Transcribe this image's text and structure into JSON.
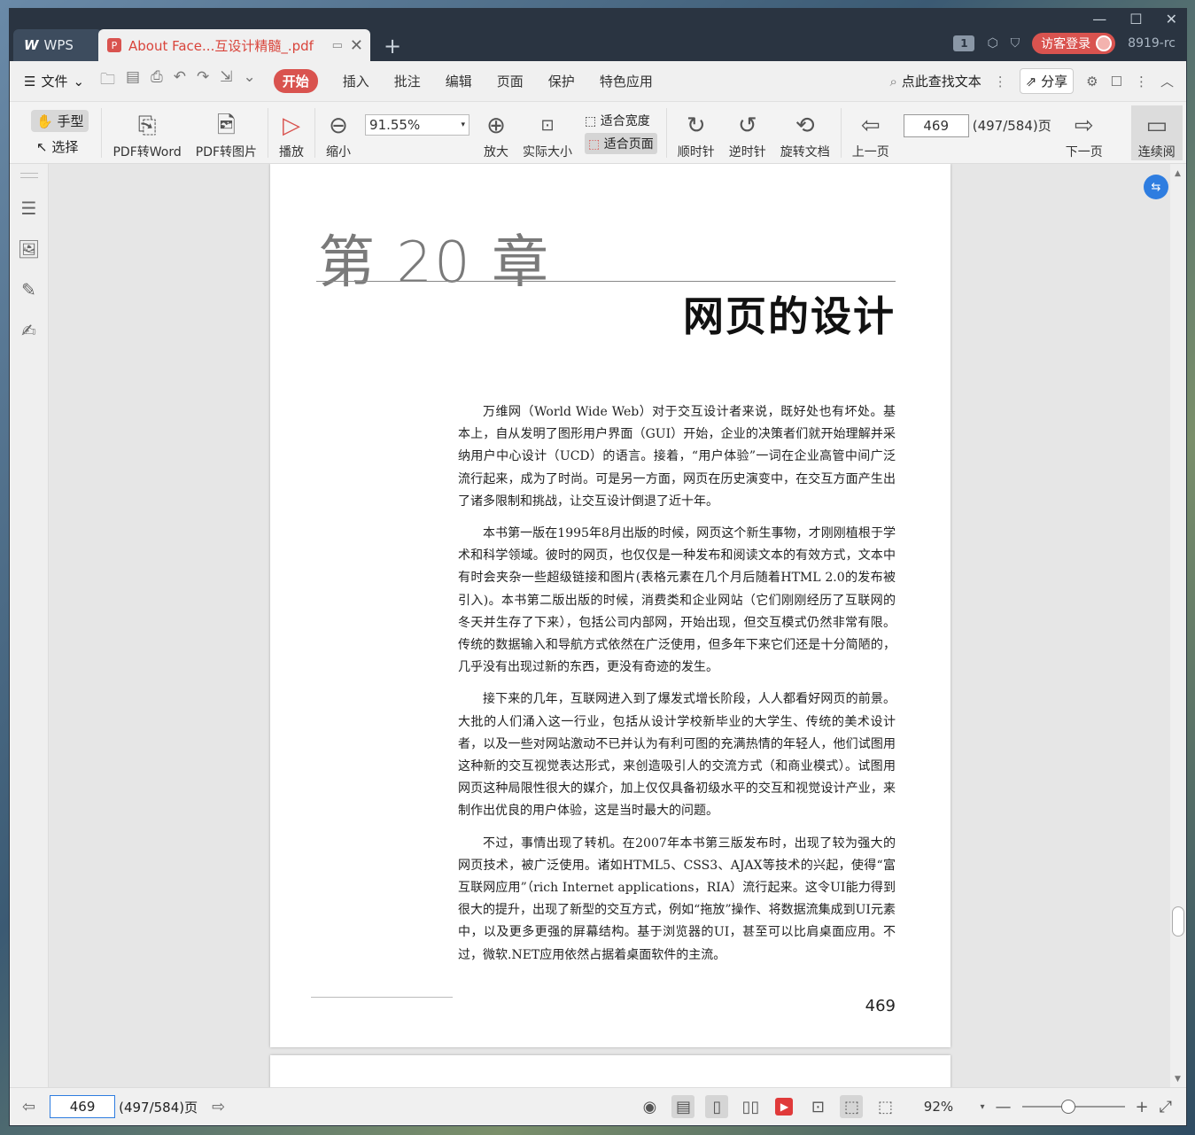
{
  "titlebar": {
    "wps_tab": "WPS",
    "doc_tab": "About Face...互设计精髓_.pdf",
    "badge": "1",
    "login": "访客登录",
    "user_id": "8919-rc"
  },
  "menubar": {
    "file": "文件",
    "items": [
      "开始",
      "插入",
      "批注",
      "编辑",
      "页面",
      "保护",
      "特色应用"
    ],
    "search": "点此查找文本",
    "share": "分享"
  },
  "toolbar": {
    "hand": "手型",
    "select": "选择",
    "pdf_to_word": "PDF转Word",
    "pdf_to_image": "PDF转图片",
    "play": "播放",
    "zoom_out": "缩小",
    "zoom_value": "91.55%",
    "zoom_in": "放大",
    "actual_size": "实际大小",
    "fit_width": "适合宽度",
    "fit_page": "适合页面",
    "clockwise": "顺时针",
    "counter_clockwise": "逆时针",
    "rotate_doc": "旋转文档",
    "prev_page": "上一页",
    "page_input": "469",
    "page_total": "(497/584)页",
    "next_page": "下一页",
    "continuous": "连续阅"
  },
  "document": {
    "chapter": "第 20 章",
    "title": "网页的设计",
    "paragraphs": [
      "万维网（World Wide Web）对于交互设计者来说，既好处也有坏处。基本上，自从发明了图形用户界面（GUI）开始，企业的决策者们就开始理解并采纳用户中心设计（UCD）的语言。接着，“用户体验”一词在企业高管中间广泛流行起来，成为了时尚。可是另一方面，网页在历史演变中，在交互方面产生出了诸多限制和挑战，让交互设计倒退了近十年。",
      "本书第一版在1995年8月出版的时候，网页这个新生事物，才刚刚植根于学术和科学领域。彼时的网页，也仅仅是一种发布和阅读文本的有效方式，文本中有时会夹杂一些超级链接和图片(表格元素在几个月后随着HTML 2.0的发布被引入)。本书第二版出版的时候，消费类和企业网站（它们刚刚经历了互联网的冬天并生存了下来），包括公司内部网，开始出现，但交互模式仍然非常有限。传统的数据输入和导航方式依然在广泛使用，但多年下来它们还是十分简陋的，几乎没有出现过新的东西，更没有奇迹的发生。",
      "接下来的几年，互联网进入到了爆发式增长阶段，人人都看好网页的前景。大批的人们涌入这一行业，包括从设计学校新毕业的大学生、传统的美术设计者，以及一些对网站激动不已并认为有利可图的充满热情的年轻人，他们试图用这种新的交互视觉表达形式，来创造吸引人的交流方式（和商业模式）。试图用网页这种局限性很大的媒介，加上仅仅具备初级水平的交互和视觉设计产业，来制作出优良的用户体验，这是当时最大的问题。",
      "不过，事情出现了转机。在2007年本书第三版发布时，出现了较为强大的网页技术，被广泛使用。诸如HTML5、CSS3、AJAX等技术的兴起，使得“富互联网应用”（rich Internet applications，RIA）流行起来。这令UI能力得到很大的提升，出现了新型的交互方式，例如“拖放”操作、将数据流集成到UI元素中，以及更多更强的屏幕结构。基于浏览器的UI，甚至可以比肩桌面应用。不过，微软.NET应用依然占据着桌面软件的主流。"
    ],
    "page_number": "469"
  },
  "statusbar": {
    "page_input": "469",
    "page_total": "(497/584)页",
    "zoom": "92%"
  },
  "colors": {
    "accent": "#d9534f",
    "titlebar": "#2a3441",
    "float_button": "#2e7de0"
  }
}
